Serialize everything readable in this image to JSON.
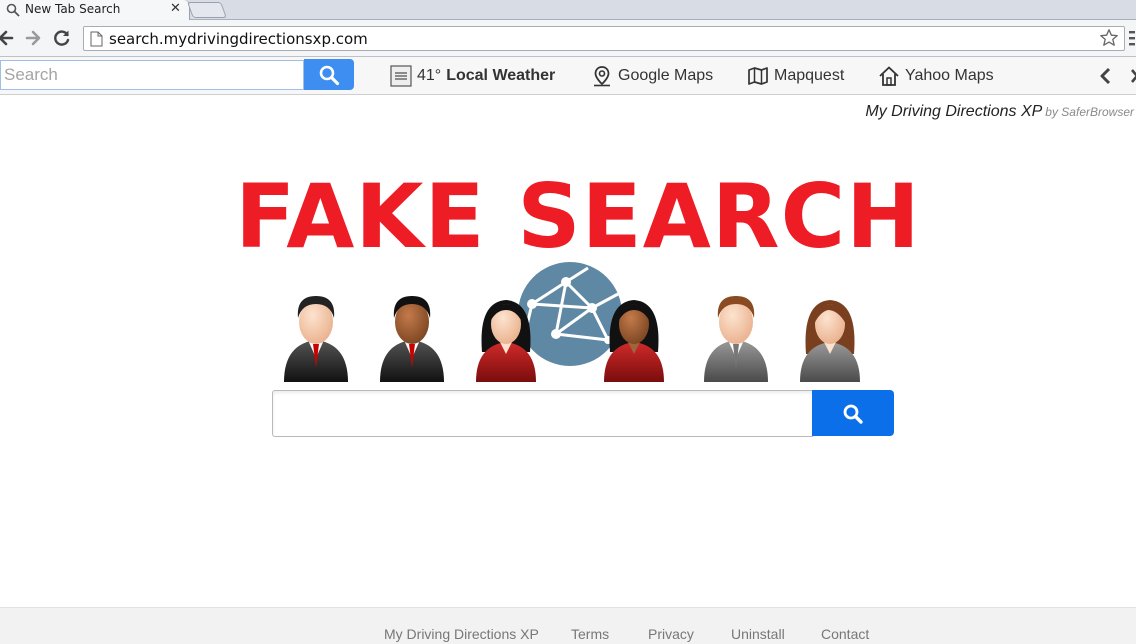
{
  "tab": {
    "title": "New Tab Search",
    "close": "✕"
  },
  "address": {
    "url": "search.mydrivingdirectionsxp.com"
  },
  "toolbar": {
    "search_placeholder": "Search",
    "weather_temp": "41°",
    "weather_label": "Local Weather",
    "google_maps": "Google Maps",
    "mapquest": "Mapquest",
    "yahoo_maps": "Yahoo Maps"
  },
  "brand": {
    "name": "My Driving Directions XP",
    "by": "by SaferBrowser"
  },
  "headline": "FAKE SEARCH",
  "main_search": {
    "value": ""
  },
  "footer": {
    "links": [
      "My Driving Directions XP",
      "Terms",
      "Privacy",
      "Uninstall",
      "Contact"
    ]
  },
  "colors": {
    "headline": "#ee1c25",
    "search_button": "#0a6fe8",
    "toolbar_search_button": "#3d8ef0",
    "globe": "#5f88a4"
  },
  "icons": {
    "tab": "search-icon",
    "nav": [
      "back-arrow-icon",
      "forward-arrow-icon",
      "reload-icon"
    ],
    "url": "page-icon",
    "star": "bookmark-star-icon",
    "weather": "weather-icon",
    "google_maps": "map-pin-icon",
    "mapquest": "map-icon",
    "yahoo_maps": "home-icon"
  }
}
